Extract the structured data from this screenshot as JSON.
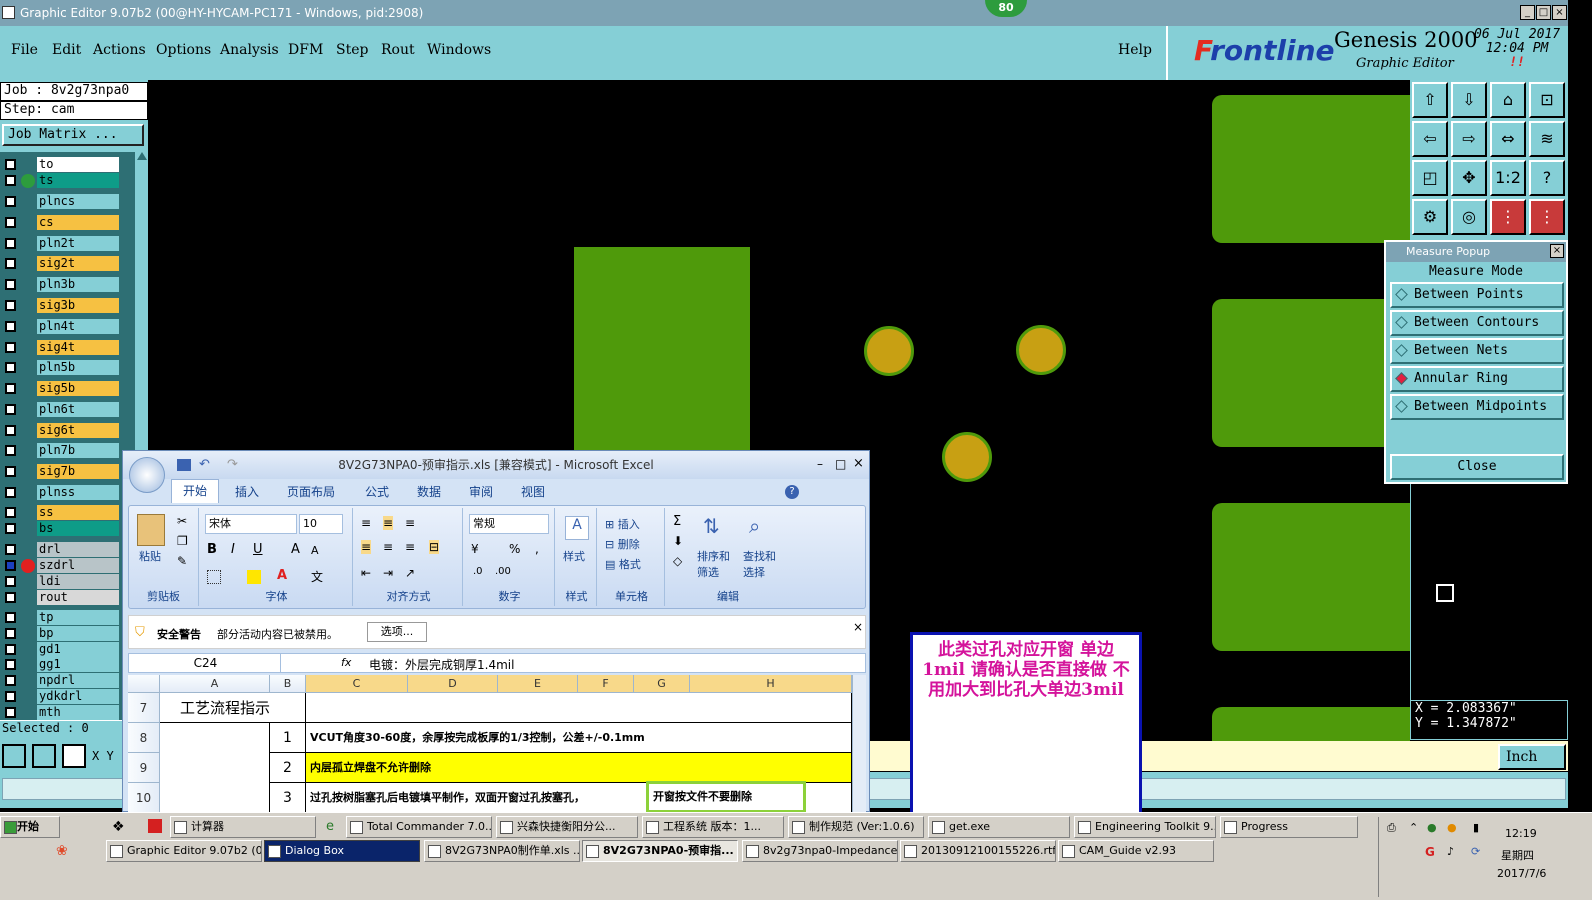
{
  "window": {
    "title": "Graphic Editor 9.07b2 (00@HY-HYCAM-PC171 - Windows, pid:2908)",
    "badge": "80"
  },
  "menu": {
    "items": [
      "File",
      "Edit",
      "Actions",
      "Options",
      "Analysis",
      "DFM",
      "Step",
      "Rout",
      "Windows"
    ],
    "help": "Help"
  },
  "brand": {
    "logo_f": "F",
    "logo_rest": "rontline",
    "product": "Genesis 2000",
    "subtitle": "Graphic Editor",
    "date": "06 Jul 2017",
    "time": "12:04 PM",
    "alert": "!!"
  },
  "job": {
    "job": "Job : 8v2g73npa0",
    "step": "Step: cam",
    "matrix_button": "Job Matrix ...",
    "selected": "Selected : 0"
  },
  "layers": [
    {
      "name": "to",
      "bg": "#ffffff",
      "dot": ""
    },
    {
      "name": "ts",
      "bg": "#0e9c88",
      "dot": "#2d9c3d"
    },
    {
      "name": "plncs",
      "bg": "#85cfd6",
      "dot": ""
    },
    {
      "name": "cs",
      "bg": "#f6c142",
      "dot": ""
    },
    {
      "name": "pln2t",
      "bg": "#85cfd6",
      "dot": ""
    },
    {
      "name": "sig2t",
      "bg": "#f6c142",
      "dot": ""
    },
    {
      "name": "pln3b",
      "bg": "#85cfd6",
      "dot": ""
    },
    {
      "name": "sig3b",
      "bg": "#f6c142",
      "dot": ""
    },
    {
      "name": "pln4t",
      "bg": "#85cfd6",
      "dot": ""
    },
    {
      "name": "sig4t",
      "bg": "#f6c142",
      "dot": ""
    },
    {
      "name": "pln5b",
      "bg": "#85cfd6",
      "dot": ""
    },
    {
      "name": "sig5b",
      "bg": "#f6c142",
      "dot": ""
    },
    {
      "name": "pln6t",
      "bg": "#85cfd6",
      "dot": ""
    },
    {
      "name": "sig6t",
      "bg": "#f6c142",
      "dot": ""
    },
    {
      "name": "pln7b",
      "bg": "#85cfd6",
      "dot": ""
    },
    {
      "name": "sig7b",
      "bg": "#f6c142",
      "dot": ""
    },
    {
      "name": "plnss",
      "bg": "#85cfd6",
      "dot": ""
    },
    {
      "name": "ss",
      "bg": "#f6c142",
      "dot": ""
    },
    {
      "name": "bs",
      "bg": "#0e9c88",
      "dot": ""
    },
    {
      "name": "drl",
      "bg": "#b8c4c8",
      "dot": ""
    },
    {
      "name": "szdrl",
      "bg": "#b8c4c8",
      "dot": "#e22020"
    },
    {
      "name": "ldi",
      "bg": "#b8c4c8",
      "dot": ""
    },
    {
      "name": "rout",
      "bg": "#d8d8d8",
      "dot": ""
    },
    {
      "name": "tp",
      "bg": "#85cfd6",
      "dot": ""
    },
    {
      "name": "bp",
      "bg": "#85cfd6",
      "dot": ""
    },
    {
      "name": "gd1",
      "bg": "#85cfd6",
      "dot": ""
    },
    {
      "name": "gg1",
      "bg": "#85cfd6",
      "dot": ""
    },
    {
      "name": "npdrl",
      "bg": "#85cfd6",
      "dot": ""
    },
    {
      "name": "ydkdrl",
      "bg": "#85cfd6",
      "dot": ""
    },
    {
      "name": "mth",
      "bg": "#85cfd6",
      "dot": ""
    }
  ],
  "left_tools": {
    "xy": "X Y"
  },
  "toolbox": {
    "icons": [
      "zoom-in-icon",
      "zoom-out-icon",
      "home-icon",
      "fit-icon",
      "pan-left-icon",
      "pan-right-icon",
      "mirror-icon",
      "snap-icon",
      "zoom-area-icon",
      "center-icon",
      "scale-icon",
      "help-icon",
      "config-icon",
      "target-icon",
      "layer-grid-icon",
      "layer-net-icon"
    ],
    "scale_label": "1:2",
    "help_label": "?"
  },
  "measure": {
    "title": "Measure Popup",
    "mode": "Measure Mode",
    "options": [
      "Between Points",
      "Between Contours",
      "Between Nets",
      "Annular Ring",
      "Between Midpoints"
    ],
    "selected_index": 3,
    "close": "Close"
  },
  "coords": {
    "x": "X = 2.083367\"",
    "y": "Y = 1.347872\""
  },
  "units": "Inch",
  "note": "此类过孔对应开窗 单边1mil  请确认是否直接做  不用加大到比孔大单边3mil",
  "excel": {
    "title": "8V2G73NPA0-预审指示.xls  [兼容模式] - Microsoft Excel",
    "tabs": [
      "开始",
      "插入",
      "页面布局",
      "公式",
      "数据",
      "审阅",
      "视图"
    ],
    "groups": [
      "剪贴板",
      "字体",
      "对齐方式",
      "数字",
      "样式",
      "单元格",
      "编辑"
    ],
    "paste": "粘贴",
    "font": "宋体",
    "size": "10",
    "number_format": "常规",
    "style": "样式",
    "insert": "插入",
    "delete": "删除",
    "format": "格式",
    "sort": "排序和筛选",
    "find": "查找和选择",
    "sigma": "Σ",
    "security_label": "安全警告",
    "security_text": "部分活动内容已被禁用。",
    "security_btn": "选项...",
    "namebox": "C24",
    "fx": "fx",
    "formula": "电镀：外层完成铜厚1.4mil",
    "cols": [
      "A",
      "B",
      "C",
      "D",
      "E",
      "F",
      "G",
      "H"
    ],
    "rows": [
      {
        "num": "7",
        "a": "工艺流程指示",
        "b": "",
        "c": ""
      },
      {
        "num": "8",
        "a": "",
        "b": "1",
        "c": "VCUT角度30-60度，余厚按完成板厚的1/3控制，公差+/-0.1mm"
      },
      {
        "num": "9",
        "a": "",
        "b": "2",
        "c": "内层孤立焊盘不允许删除"
      },
      {
        "num": "10",
        "a": "",
        "b": "3",
        "c": "过孔按树脂塞孔后电镀填平制作，双面开窗过孔按塞孔，"
      }
    ],
    "callout": "开窗按文件不要删除"
  },
  "taskbar": {
    "start": "开始",
    "row1": [
      "计算器",
      "Total Commander 7.0...",
      "兴森快捷衡阳分公...",
      "工程系统  版本：1...",
      "制作规范 (Ver:1.0.6)",
      "get.exe",
      "Engineering Toolkit 9....",
      "Progress"
    ],
    "row2": [
      "Graphic Editor 9.07b2 (0...",
      "Dialog Box",
      "8V2G73NPA0制作单.xls ...",
      "8V2G73NPA0-预审指...",
      "8v2g73npa0-Impedance ...",
      "20130912100155226.rtf...",
      "CAM_Guide v2.93"
    ],
    "active_index": 1,
    "clock": "12:19",
    "weekday": "星期四",
    "date": "2017/7/6"
  }
}
